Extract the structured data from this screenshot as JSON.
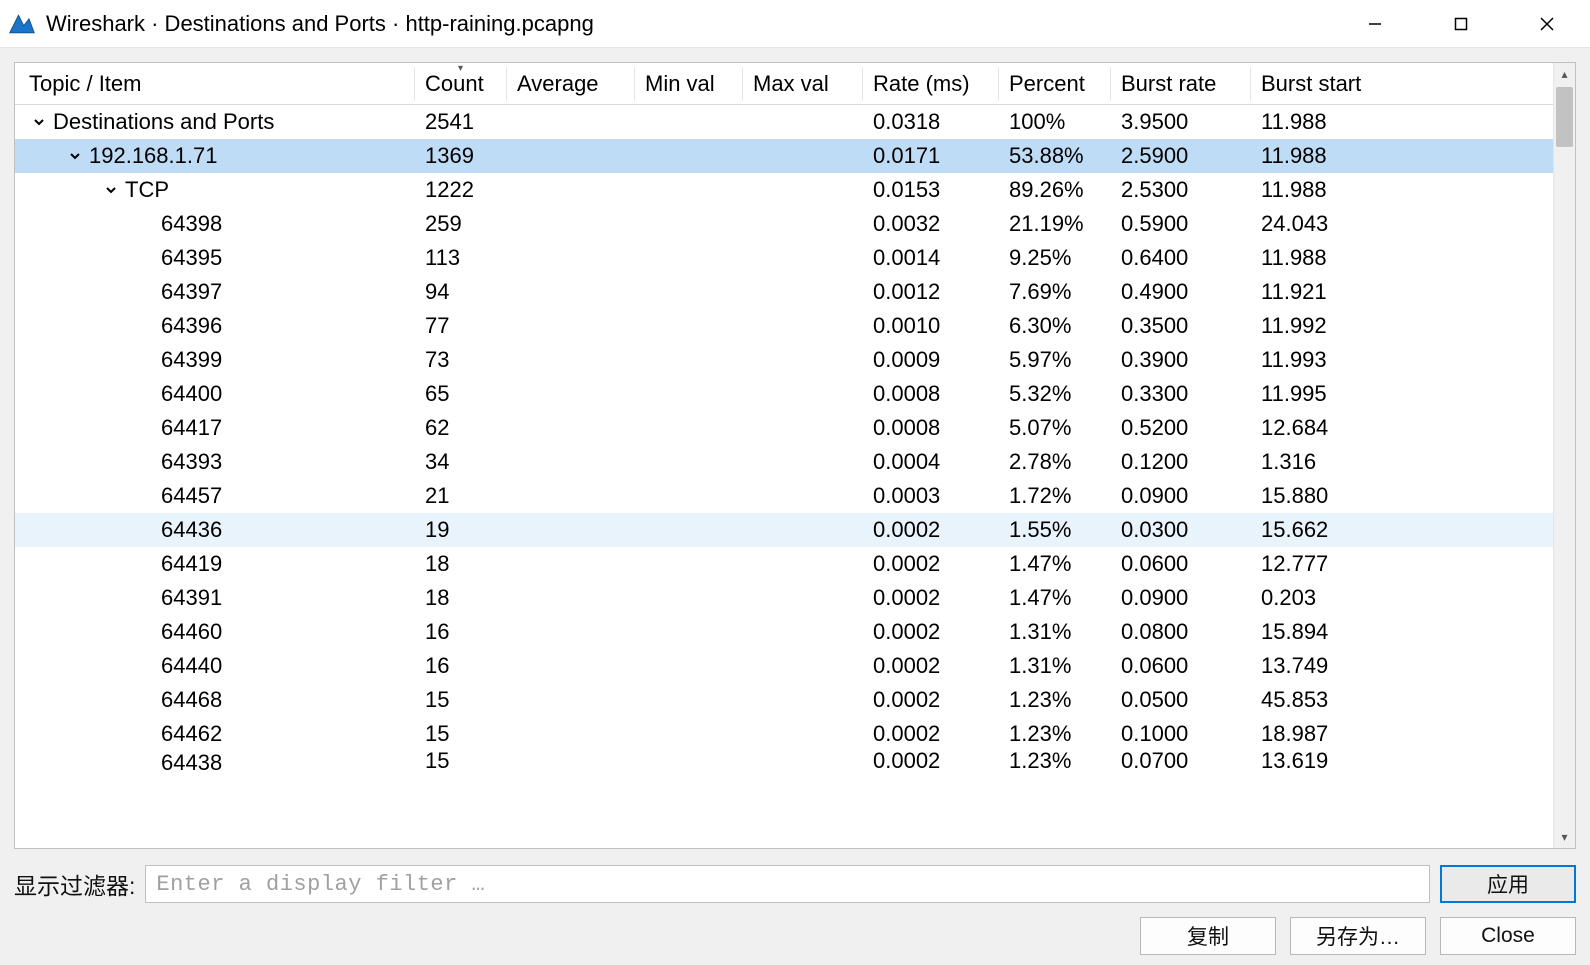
{
  "window": {
    "title": "Wireshark · Destinations and Ports · http-raining.pcapng"
  },
  "columns": {
    "topic": "Topic / Item",
    "count": "Count",
    "average": "Average",
    "minval": "Min val",
    "maxval": "Max val",
    "rate": "Rate (ms)",
    "percent": "Percent",
    "brate": "Burst rate",
    "bstart": "Burst start"
  },
  "sort_column": "count",
  "rows": [
    {
      "depth": 0,
      "exp": "open",
      "topic": "Destinations and Ports",
      "count": "2541",
      "average": "",
      "minval": "",
      "maxval": "",
      "rate": "0.0318",
      "percent": "100%",
      "brate": "3.9500",
      "bstart": "11.988",
      "sel": false,
      "hov": false
    },
    {
      "depth": 1,
      "exp": "open",
      "topic": "192.168.1.71",
      "count": "1369",
      "average": "",
      "minval": "",
      "maxval": "",
      "rate": "0.0171",
      "percent": "53.88%",
      "brate": "2.5900",
      "bstart": "11.988",
      "sel": true,
      "hov": false
    },
    {
      "depth": 2,
      "exp": "open",
      "topic": "TCP",
      "count": "1222",
      "average": "",
      "minval": "",
      "maxval": "",
      "rate": "0.0153",
      "percent": "89.26%",
      "brate": "2.5300",
      "bstart": "11.988",
      "sel": false,
      "hov": false
    },
    {
      "depth": 3,
      "exp": "none",
      "topic": "64398",
      "count": "259",
      "average": "",
      "minval": "",
      "maxval": "",
      "rate": "0.0032",
      "percent": "21.19%",
      "brate": "0.5900",
      "bstart": "24.043",
      "sel": false,
      "hov": false
    },
    {
      "depth": 3,
      "exp": "none",
      "topic": "64395",
      "count": "113",
      "average": "",
      "minval": "",
      "maxval": "",
      "rate": "0.0014",
      "percent": "9.25%",
      "brate": "0.6400",
      "bstart": "11.988",
      "sel": false,
      "hov": false
    },
    {
      "depth": 3,
      "exp": "none",
      "topic": "64397",
      "count": "94",
      "average": "",
      "minval": "",
      "maxval": "",
      "rate": "0.0012",
      "percent": "7.69%",
      "brate": "0.4900",
      "bstart": "11.921",
      "sel": false,
      "hov": false
    },
    {
      "depth": 3,
      "exp": "none",
      "topic": "64396",
      "count": "77",
      "average": "",
      "minval": "",
      "maxval": "",
      "rate": "0.0010",
      "percent": "6.30%",
      "brate": "0.3500",
      "bstart": "11.992",
      "sel": false,
      "hov": false
    },
    {
      "depth": 3,
      "exp": "none",
      "topic": "64399",
      "count": "73",
      "average": "",
      "minval": "",
      "maxval": "",
      "rate": "0.0009",
      "percent": "5.97%",
      "brate": "0.3900",
      "bstart": "11.993",
      "sel": false,
      "hov": false
    },
    {
      "depth": 3,
      "exp": "none",
      "topic": "64400",
      "count": "65",
      "average": "",
      "minval": "",
      "maxval": "",
      "rate": "0.0008",
      "percent": "5.32%",
      "brate": "0.3300",
      "bstart": "11.995",
      "sel": false,
      "hov": false
    },
    {
      "depth": 3,
      "exp": "none",
      "topic": "64417",
      "count": "62",
      "average": "",
      "minval": "",
      "maxval": "",
      "rate": "0.0008",
      "percent": "5.07%",
      "brate": "0.5200",
      "bstart": "12.684",
      "sel": false,
      "hov": false
    },
    {
      "depth": 3,
      "exp": "none",
      "topic": "64393",
      "count": "34",
      "average": "",
      "minval": "",
      "maxval": "",
      "rate": "0.0004",
      "percent": "2.78%",
      "brate": "0.1200",
      "bstart": "1.316",
      "sel": false,
      "hov": false
    },
    {
      "depth": 3,
      "exp": "none",
      "topic": "64457",
      "count": "21",
      "average": "",
      "minval": "",
      "maxval": "",
      "rate": "0.0003",
      "percent": "1.72%",
      "brate": "0.0900",
      "bstart": "15.880",
      "sel": false,
      "hov": false
    },
    {
      "depth": 3,
      "exp": "none",
      "topic": "64436",
      "count": "19",
      "average": "",
      "minval": "",
      "maxval": "",
      "rate": "0.0002",
      "percent": "1.55%",
      "brate": "0.0300",
      "bstart": "15.662",
      "sel": false,
      "hov": true
    },
    {
      "depth": 3,
      "exp": "none",
      "topic": "64419",
      "count": "18",
      "average": "",
      "minval": "",
      "maxval": "",
      "rate": "0.0002",
      "percent": "1.47%",
      "brate": "0.0600",
      "bstart": "12.777",
      "sel": false,
      "hov": false
    },
    {
      "depth": 3,
      "exp": "none",
      "topic": "64391",
      "count": "18",
      "average": "",
      "minval": "",
      "maxval": "",
      "rate": "0.0002",
      "percent": "1.47%",
      "brate": "0.0900",
      "bstart": "0.203",
      "sel": false,
      "hov": false
    },
    {
      "depth": 3,
      "exp": "none",
      "topic": "64460",
      "count": "16",
      "average": "",
      "minval": "",
      "maxval": "",
      "rate": "0.0002",
      "percent": "1.31%",
      "brate": "0.0800",
      "bstart": "15.894",
      "sel": false,
      "hov": false
    },
    {
      "depth": 3,
      "exp": "none",
      "topic": "64440",
      "count": "16",
      "average": "",
      "minval": "",
      "maxval": "",
      "rate": "0.0002",
      "percent": "1.31%",
      "brate": "0.0600",
      "bstart": "13.749",
      "sel": false,
      "hov": false
    },
    {
      "depth": 3,
      "exp": "none",
      "topic": "64468",
      "count": "15",
      "average": "",
      "minval": "",
      "maxval": "",
      "rate": "0.0002",
      "percent": "1.23%",
      "brate": "0.0500",
      "bstart": "45.853",
      "sel": false,
      "hov": false
    },
    {
      "depth": 3,
      "exp": "none",
      "topic": "64462",
      "count": "15",
      "average": "",
      "minval": "",
      "maxval": "",
      "rate": "0.0002",
      "percent": "1.23%",
      "brate": "0.1000",
      "bstart": "18.987",
      "sel": false,
      "hov": false
    },
    {
      "depth": 3,
      "exp": "none",
      "topic": "64438",
      "count": "15",
      "average": "",
      "minval": "",
      "maxval": "",
      "rate": "0.0002",
      "percent": "1.23%",
      "brate": "0.0700",
      "bstart": "13.619",
      "sel": false,
      "hov": false,
      "cut": true
    }
  ],
  "filter": {
    "label": "显示过滤器:",
    "placeholder": "Enter a display filter …"
  },
  "buttons": {
    "apply": "应用",
    "copy": "复制",
    "saveas": "另存为…",
    "close": "Close"
  }
}
